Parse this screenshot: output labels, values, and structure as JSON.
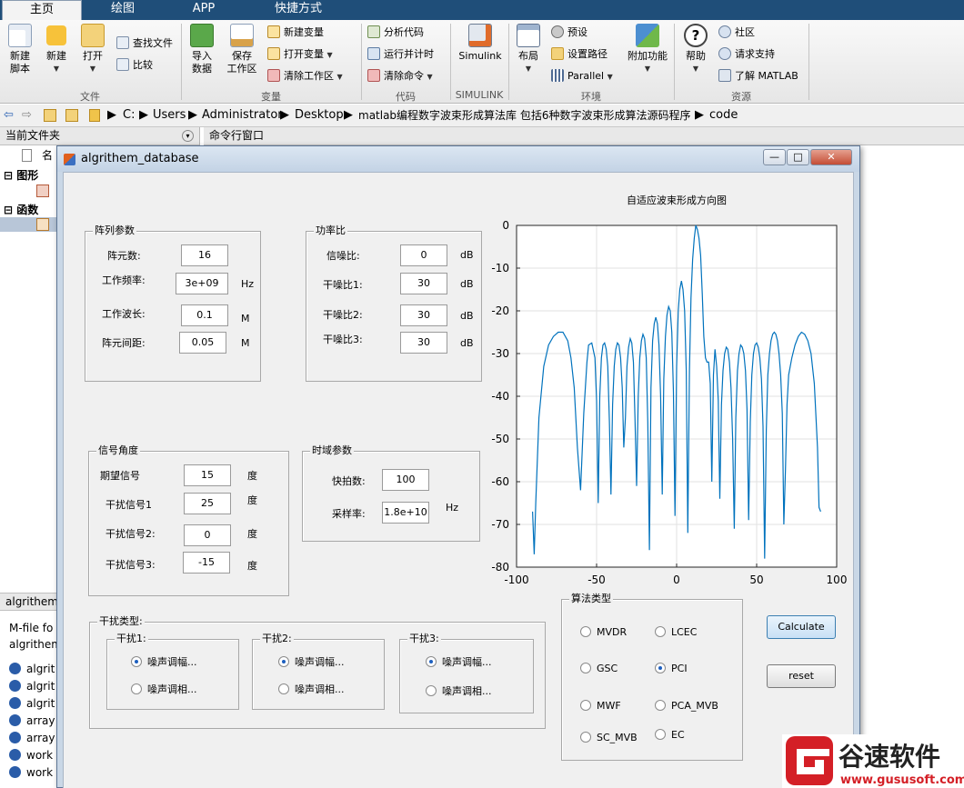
{
  "ribbon": {
    "tabs": [
      "主页",
      "绘图",
      "APP",
      "快捷方式"
    ],
    "file": {
      "new_script": "新建\n脚本",
      "new": "新建",
      "open": "打开",
      "find_files": "查找文件",
      "compare": "比较",
      "group": "文件"
    },
    "variable": {
      "import": "导入\n数据",
      "save_ws": "保存\n工作区",
      "new_var": "新建变量",
      "open_var": "打开变量",
      "clear_ws": "清除工作区",
      "group": "变量"
    },
    "code": {
      "analyze": "分析代码",
      "run_time": "运行并计时",
      "clear_cmd": "清除命令",
      "group": "代码"
    },
    "simulink": {
      "btn": "Simulink",
      "group": "SIMULINK"
    },
    "env": {
      "layout": "布局",
      "prefs": "预设",
      "set_path": "设置路径",
      "parallel": "Parallel",
      "addons": "附加功能",
      "group": "环境"
    },
    "res": {
      "help": "帮助",
      "community": "社区",
      "support": "请求支持",
      "learn": "了解 MATLAB",
      "group": "资源"
    }
  },
  "address": {
    "crumbs": [
      "C:",
      "Users",
      "Administrator",
      "Desktop",
      "matlab编程数字波束形成算法库 包括6种数字波束形成算法源码程序",
      "code"
    ]
  },
  "left": {
    "header": "当前文件夹",
    "col": "名",
    "group1": "图形",
    "group2": "函数",
    "detail_header": "algrithem",
    "detail_line1": "M-file fo",
    "detail_line2": "algrithem",
    "files": [
      "algrit",
      "algrit",
      "algrit",
      "array",
      "array",
      "work",
      "work"
    ]
  },
  "cmd": {
    "header": "命令行窗口"
  },
  "figure": {
    "title": "algrithem_database",
    "array_panel": {
      "title": "阵列参数",
      "rows": [
        {
          "label": "阵元数:",
          "value": "16",
          "unit": ""
        },
        {
          "label": "工作频率:",
          "value": "3e+09",
          "unit": "Hz"
        },
        {
          "label": "工作波长:",
          "value": "0.1",
          "unit": "M"
        },
        {
          "label": "阵元间距:",
          "value": "0.05",
          "unit": "M"
        }
      ]
    },
    "power_panel": {
      "title": "功率比",
      "rows": [
        {
          "label": "信噪比:",
          "value": "0",
          "unit": "dB"
        },
        {
          "label": "干噪比1:",
          "value": "30",
          "unit": "dB"
        },
        {
          "label": "干噪比2:",
          "value": "30",
          "unit": "dB"
        },
        {
          "label": "干噪比3:",
          "value": "30",
          "unit": "dB"
        }
      ]
    },
    "angle_panel": {
      "title": "信号角度",
      "rows": [
        {
          "label": "期望信号",
          "value": "15",
          "unit": "度"
        },
        {
          "label": "干扰信号1",
          "value": "25",
          "unit": "度"
        },
        {
          "label": "干扰信号2:",
          "value": "0",
          "unit": "度"
        },
        {
          "label": "干扰信号3:",
          "value": "-15",
          "unit": "度"
        }
      ]
    },
    "time_panel": {
      "title": "时域参数",
      "rows": [
        {
          "label": "快拍数:",
          "value": "100"
        },
        {
          "label": "采样率:",
          "value": "1.8e+10",
          "unit": "Hz"
        }
      ]
    },
    "interf_panel": {
      "title": "干扰类型:",
      "groups": [
        {
          "title": "干扰1:",
          "opt1": "噪声调幅...",
          "opt2": "噪声调相..."
        },
        {
          "title": "干扰2:",
          "opt1": "噪声调幅...",
          "opt2": "噪声调相..."
        },
        {
          "title": "干扰3:",
          "opt1": "噪声调幅...",
          "opt2": "噪声调相..."
        }
      ]
    },
    "algo_panel": {
      "title": "算法类型",
      "options": [
        "MVDR",
        "LCEC",
        "GSC",
        "PCI",
        "MWF",
        "PCA_MVB",
        "SC_MVB",
        "EC"
      ],
      "selected": "PCI"
    },
    "buttons": {
      "calculate": "Calculate",
      "reset": "reset"
    }
  },
  "chart_data": {
    "type": "line",
    "title": "自适应波束形成方向图",
    "xlabel": "",
    "ylabel": "",
    "xlim": [
      -100,
      100
    ],
    "ylim": [
      -80,
      0
    ],
    "xticks": [
      -100,
      -50,
      0,
      50,
      100
    ],
    "yticks": [
      0,
      -10,
      -20,
      -30,
      -40,
      -50,
      -60,
      -70,
      -80
    ],
    "grid": true,
    "series": [
      {
        "x": [
          -90,
          -89,
          -88,
          -86,
          -83,
          -80,
          -77,
          -74,
          -71,
          -68,
          -66,
          -64,
          -62,
          -60,
          -58,
          -56,
          -55,
          -53,
          -51,
          -50,
          -49,
          -48,
          -47,
          -46,
          -45,
          -44,
          -43,
          -42,
          -41,
          -40,
          -39,
          -38,
          -37,
          -36,
          -35,
          -34,
          -33,
          -32,
          -31,
          -30,
          -29,
          -28,
          -27,
          -26,
          -25,
          -24,
          -23,
          -22,
          -21,
          -20,
          -19,
          -18,
          -17,
          -16,
          -15,
          -14,
          -13,
          -12,
          -11,
          -10,
          -9,
          -8,
          -7,
          -6,
          -5,
          -4,
          -3,
          -2,
          -1,
          0,
          1,
          2,
          3,
          4,
          5,
          6,
          7,
          8,
          9,
          10,
          11,
          12,
          13,
          14,
          15,
          16,
          17,
          18,
          19,
          20,
          21,
          22,
          23,
          24,
          25,
          26,
          27,
          28,
          29,
          30,
          31,
          32,
          33,
          34,
          35,
          36,
          37,
          38,
          39,
          40,
          41,
          42,
          43,
          44,
          45,
          46,
          47,
          48,
          49,
          50,
          51,
          52,
          53,
          54,
          55,
          56,
          57,
          58,
          59,
          60,
          61,
          62,
          63,
          64,
          65,
          66,
          67,
          68,
          69,
          70,
          72,
          74,
          76,
          78,
          80,
          82,
          84,
          86,
          88,
          89,
          90
        ],
        "y": [
          -67,
          -77,
          -65,
          -45,
          -33,
          -28,
          -26,
          -25,
          -25,
          -27,
          -31,
          -38,
          -52,
          -62,
          -44,
          -32,
          -28,
          -27.5,
          -31,
          -41,
          -65,
          -40,
          -31,
          -28,
          -27.5,
          -29,
          -33,
          -46,
          -63,
          -42,
          -33,
          -29,
          -27.5,
          -28,
          -31,
          -38,
          -52,
          -45,
          -33,
          -28.5,
          -26.5,
          -27.5,
          -32,
          -45,
          -61,
          -40,
          -31,
          -27,
          -25.5,
          -26.5,
          -31,
          -46,
          -76,
          -38,
          -27,
          -23,
          -21.5,
          -23,
          -28,
          -40,
          -63,
          -36,
          -26,
          -21,
          -19,
          -20,
          -25,
          -39,
          -68,
          -33,
          -20,
          -15,
          -13,
          -15,
          -20,
          -34,
          -72,
          -34,
          -17,
          -8,
          -3,
          0,
          -1,
          -3,
          -7,
          -16,
          -26,
          -31,
          -32,
          -32,
          -37,
          -60,
          -35,
          -29,
          -33,
          -41,
          -64,
          -42,
          -34,
          -30,
          -28.5,
          -29,
          -32,
          -38,
          -50,
          -71,
          -45,
          -34,
          -30,
          -28,
          -28.5,
          -30,
          -34,
          -43,
          -69,
          -46,
          -35,
          -30,
          -28,
          -27.5,
          -28.5,
          -31,
          -36,
          -47,
          -78,
          -48,
          -35,
          -30,
          -27,
          -25.5,
          -25,
          -25.5,
          -27,
          -30,
          -35,
          -44,
          -70,
          -57,
          -42,
          -35,
          -31,
          -28,
          -26,
          -25,
          -25.5,
          -27,
          -30,
          -37,
          -52,
          -66,
          -67
        ]
      }
    ]
  }
}
